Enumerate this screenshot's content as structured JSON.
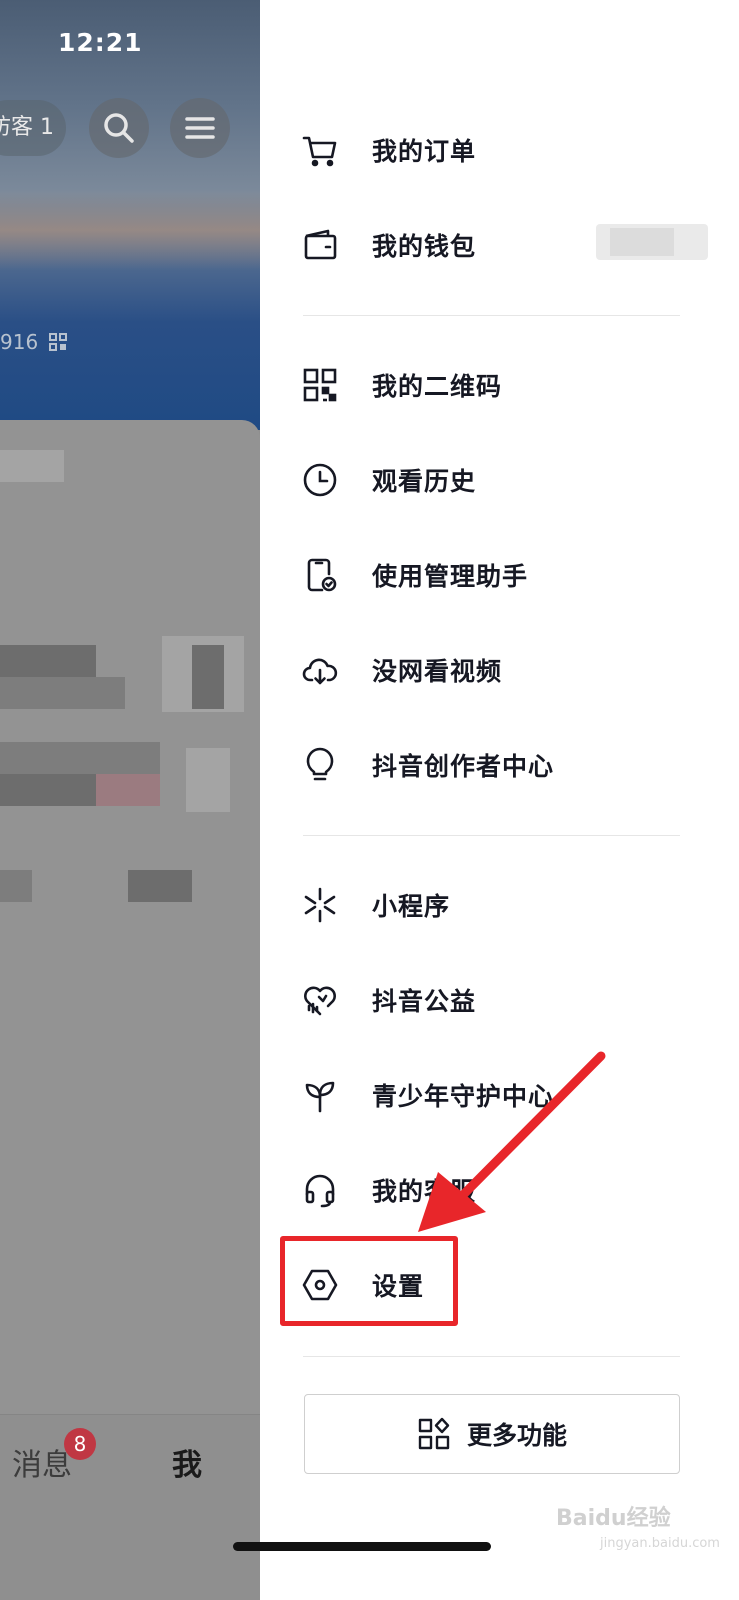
{
  "status_bar": {
    "time": "12:21"
  },
  "background_page": {
    "visitor_label": "访客 1",
    "uid_fragment": "916",
    "tabbar": {
      "messages_label": "消息",
      "messages_badge": "8",
      "me_label": "我"
    }
  },
  "drawer": {
    "groups": [
      [
        {
          "label": "我的订单",
          "icon": "cart-icon"
        },
        {
          "label": "我的钱包",
          "icon": "wallet-icon"
        }
      ],
      [
        {
          "label": "我的二维码",
          "icon": "qr-code-icon"
        },
        {
          "label": "观看历史",
          "icon": "clock-icon"
        },
        {
          "label": "使用管理助手",
          "icon": "phone-check-icon"
        },
        {
          "label": "没网看视频",
          "icon": "cloud-download-icon"
        },
        {
          "label": "抖音创作者中心",
          "icon": "lightbulb-icon"
        }
      ],
      [
        {
          "label": "小程序",
          "icon": "mini-program-icon"
        },
        {
          "label": "抖音公益",
          "icon": "heart-charity-icon"
        },
        {
          "label": "青少年守护中心",
          "icon": "sprout-icon"
        },
        {
          "label": "我的客服",
          "icon": "headset-icon"
        },
        {
          "label": "设置",
          "icon": "settings-hexagon-icon"
        }
      ]
    ],
    "more_button_label": "更多功能"
  },
  "annotation": {
    "highlight_color": "#e8262a",
    "target": "设置"
  },
  "watermark": {
    "text": "Baidu经验",
    "sub": "jingyan.baidu.com"
  }
}
